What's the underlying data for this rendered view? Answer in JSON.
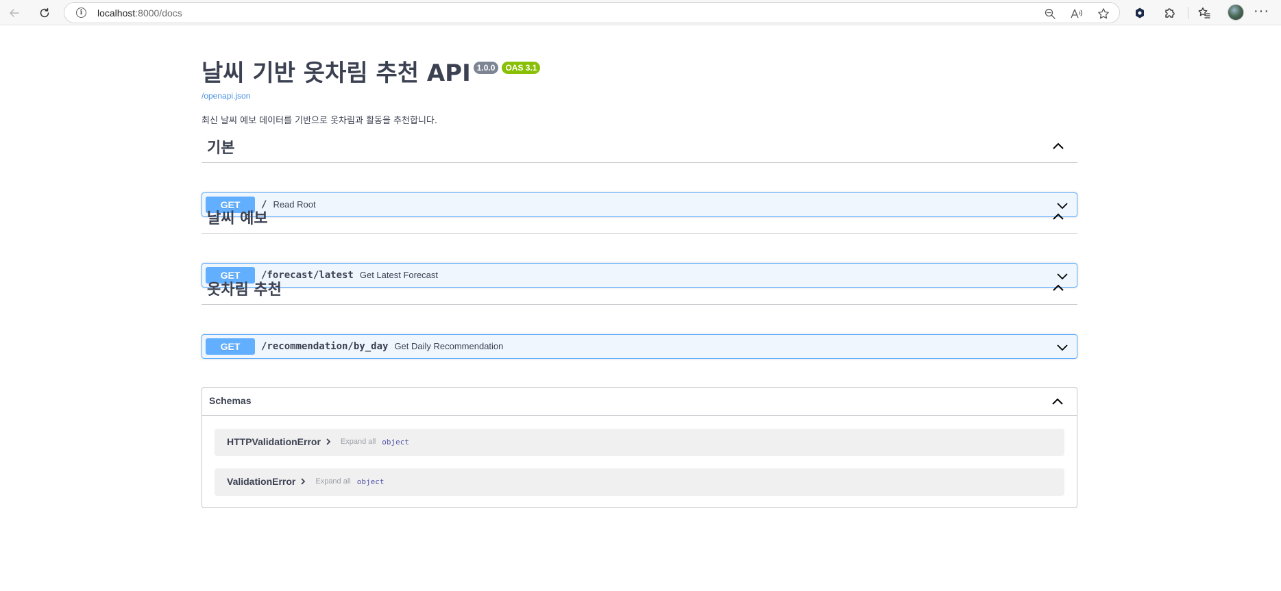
{
  "browser": {
    "url_host": "localhost",
    "url_path": ":8000/docs"
  },
  "api": {
    "title": "날씨 기반 옷차림 추천 API",
    "version": "1.0.0",
    "oas": "OAS 3.1",
    "spec_link": "/openapi.json",
    "description": "최신 날씨 예보 데이터를 기반으로 옷차림과 활동을 추천합니다."
  },
  "tags": [
    {
      "name": "기본",
      "operations": [
        {
          "method": "GET",
          "path": "/",
          "summary": "Read Root"
        }
      ]
    },
    {
      "name": "날씨 예보",
      "operations": [
        {
          "method": "GET",
          "path": "/forecast/latest",
          "summary": "Get Latest Forecast"
        }
      ]
    },
    {
      "name": "옷차림 추천",
      "operations": [
        {
          "method": "GET",
          "path": "/recommendation/by_day",
          "summary": "Get Daily Recommendation"
        }
      ]
    }
  ],
  "schemas": {
    "title": "Schemas",
    "models": [
      {
        "name": "HTTPValidationError",
        "expand_label": "Expand all",
        "type": "object"
      },
      {
        "name": "ValidationError",
        "expand_label": "Expand all",
        "type": "object"
      }
    ]
  },
  "colors": {
    "get_method": "#61affe",
    "get_block_bg": "#eff6fd",
    "version_badge": "#7d8492",
    "oas_badge": "#89bf04",
    "link": "#4990e2",
    "text": "#3b4151"
  },
  "icons": {
    "back": "arrow-left-icon",
    "reload": "reload-icon",
    "site_info": "info-icon",
    "zoom": "zoom-out-icon",
    "read_aloud": "read-aloud-icon",
    "favorite": "star-icon",
    "extension_shield": "extension-shield-icon",
    "extensions": "puzzle-icon",
    "favorites_list": "favorites-icon",
    "profile": "avatar",
    "menu": "more-icon",
    "collapse": "chevron-up-icon",
    "expand": "chevron-down-icon"
  }
}
